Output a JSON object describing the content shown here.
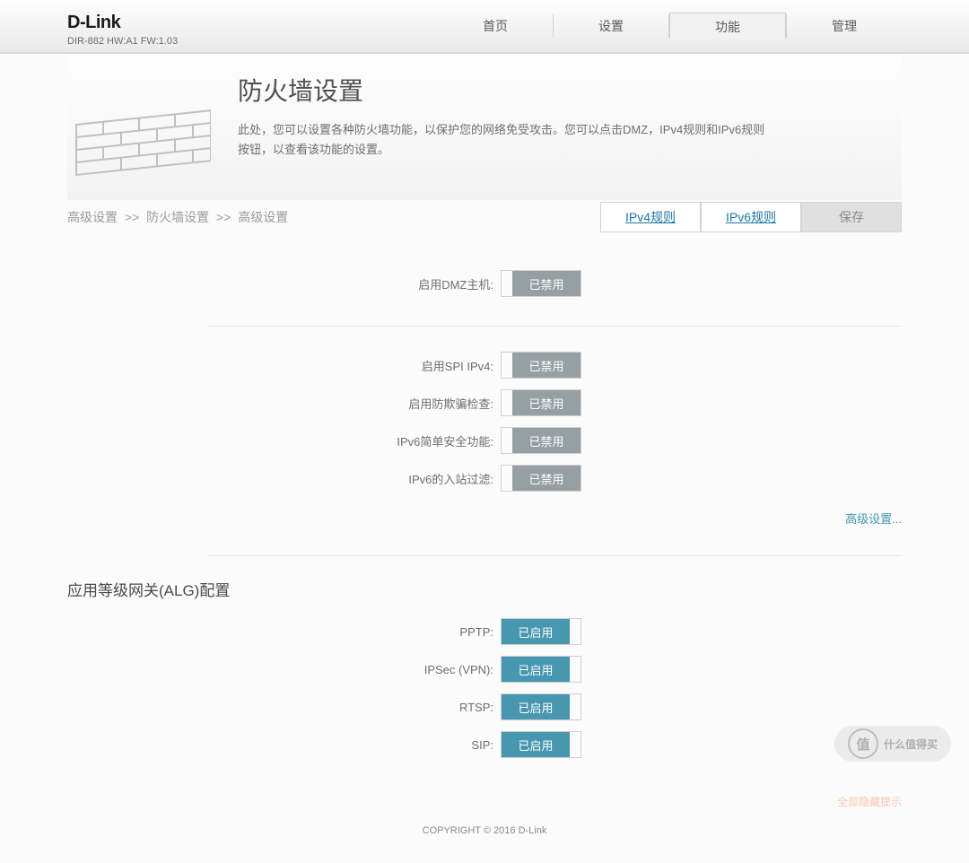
{
  "brand": {
    "name": "D-Link",
    "model": "DIR-882 HW:A1 FW:1.03"
  },
  "nav": {
    "home": "首页",
    "settings": "设置",
    "features": "功能",
    "manage": "管理"
  },
  "hero": {
    "title": "防火墙设置",
    "desc": "此处，您可以设置各种防火墙功能，以保护您的网络免受攻击。您可以点击DMZ，IPv4规则和IPv6规则按钮，以查看该功能的设置。"
  },
  "breadcrumb": {
    "a": "高级设置",
    "b": "防火墙设置",
    "c": "高级设置",
    "sep": ">>"
  },
  "actions": {
    "ipv4": "IPv4规则",
    "ipv6": "IPv6规则",
    "save": "保存"
  },
  "labels": {
    "dmz": "启用DMZ主机:",
    "spi": "启用SPI IPv4:",
    "spoof": "启用防欺骗检查:",
    "ipv6simple": "IPv6简单安全功能:",
    "ipv6in": "IPv6的入站过滤:",
    "pptp": "PPTP:",
    "ipsec": "IPSec (VPN):",
    "rtsp": "RTSP:",
    "sip": "SIP:"
  },
  "toggle": {
    "disabled": "已禁用",
    "enabled": "已启用"
  },
  "advancedLink": "高级设置...",
  "algTitle": "应用等级网关(ALG)配置",
  "footerLink": "全部隐藏提示",
  "copyright": "COPYRIGHT © 2016 D-Link",
  "watermark": "什么值得买"
}
